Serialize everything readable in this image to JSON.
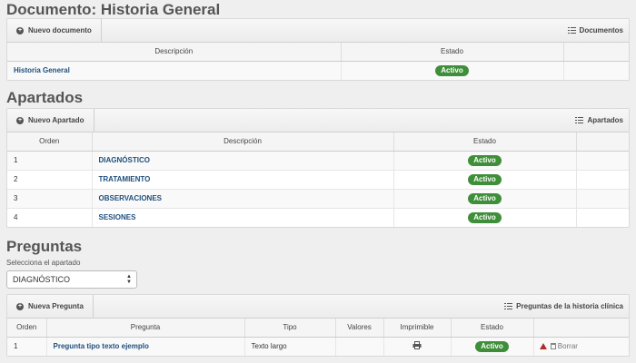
{
  "documento": {
    "heading": "Documento: Historia General",
    "new_button": "Nuevo documento",
    "list_link": "Documentos",
    "columns": [
      "Descripción",
      "Estado",
      ""
    ],
    "rows": [
      {
        "descripcion": "Historia General",
        "estado": "Activo"
      }
    ]
  },
  "apartados": {
    "heading": "Apartados",
    "new_button": "Nuevo Apartado",
    "list_link": "Apartados",
    "columns": [
      "Orden",
      "Descripción",
      "Estado",
      ""
    ],
    "rows": [
      {
        "orden": "1",
        "descripcion": "DIAGNÓSTICO",
        "estado": "Activo"
      },
      {
        "orden": "2",
        "descripcion": "TRATAMIENTO",
        "estado": "Activo"
      },
      {
        "orden": "3",
        "descripcion": "OBSERVACIONES",
        "estado": "Activo"
      },
      {
        "orden": "4",
        "descripcion": "SESIONES",
        "estado": "Activo"
      }
    ]
  },
  "preguntas": {
    "heading": "Preguntas",
    "select_label": "Selecciona el apartado",
    "select_value": "DIAGNÓSTICO",
    "new_button": "Nueva Pregunta",
    "list_link": "Preguntas de la historia clínica",
    "columns": [
      "Orden",
      "Pregunta",
      "Tipo",
      "Valores",
      "Imprimible",
      "Estado",
      ""
    ],
    "rows": [
      {
        "orden": "1",
        "pregunta": "Pregunta tipo texto ejemplo",
        "tipo": "Texto largo",
        "valores": "",
        "imprimible_icon": "printer-icon",
        "estado": "Activo",
        "borrar": "Borrar"
      }
    ]
  },
  "colors": {
    "accent_link": "#1f4f7d",
    "status_active": "#3f8f3a",
    "warning": "#b22b2b"
  }
}
